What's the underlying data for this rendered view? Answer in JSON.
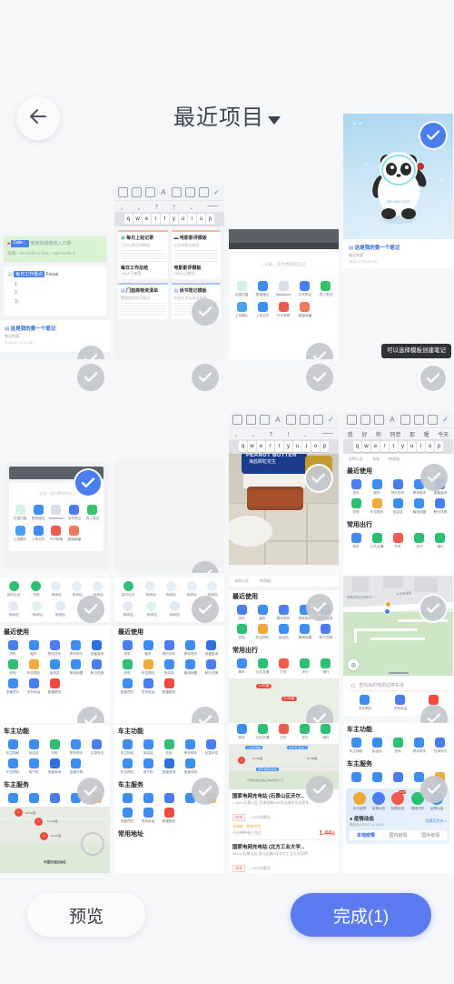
{
  "header": {
    "title": "最近项目",
    "back_icon": "arrow-left-icon",
    "caret_icon": "chevron-down-icon"
  },
  "tooltip": {
    "text": "可以选择模板创建笔记"
  },
  "bottom_bar": {
    "preview_label": "预览",
    "done_label": "完成(1)",
    "done_color": "#5b7cf0"
  },
  "selection": {
    "selected_count": 1,
    "check_icon": "check-icon",
    "selected_border_color": "#ef2f2f",
    "checked_color": "#4a7df0",
    "unchecked_color": "#c4c7cc"
  },
  "grid": {
    "columns": 4,
    "items": [
      {
        "id": "r1c1",
        "kind": "note-editor",
        "checked": false,
        "selected": false
      },
      {
        "id": "r1c2",
        "kind": "note-templates",
        "checked": false,
        "selected": false
      },
      {
        "id": "r1c3",
        "kind": "note-toolgrid",
        "checked": false,
        "selected": false
      },
      {
        "id": "r1c4",
        "kind": "panda-note",
        "checked": true,
        "selected": false
      },
      {
        "id": "r2c1",
        "kind": "note-firstnote",
        "checked": false,
        "selected": false
      },
      {
        "id": "r2c2",
        "kind": "blank",
        "checked": false,
        "selected": false
      },
      {
        "id": "r2c3",
        "kind": "blank",
        "checked": false,
        "selected": false
      },
      {
        "id": "r2c4",
        "kind": "tooltip-shot",
        "checked": false,
        "selected": false
      },
      {
        "id": "r3c1",
        "kind": "note-toolgrid-selected",
        "checked": true,
        "selected": true
      },
      {
        "id": "r3c2",
        "kind": "blank",
        "checked": false,
        "selected": false
      },
      {
        "id": "r3c3",
        "kind": "peanut-photo",
        "checked": false,
        "selected": false
      },
      {
        "id": "r3c4",
        "kind": "car-app-kb",
        "checked": false,
        "selected": false
      },
      {
        "id": "r4c1",
        "kind": "car-app-a",
        "checked": false,
        "selected": false
      },
      {
        "id": "r4c2",
        "kind": "car-app-a",
        "checked": false,
        "selected": false
      },
      {
        "id": "r4c3",
        "kind": "car-app-b",
        "checked": false,
        "selected": false
      },
      {
        "id": "r4c4",
        "kind": "map-parking",
        "checked": false,
        "selected": false
      },
      {
        "id": "r5c1",
        "kind": "car-app-c",
        "checked": false,
        "selected": false
      },
      {
        "id": "r5c2",
        "kind": "car-app-c",
        "checked": false,
        "selected": false
      },
      {
        "id": "r5c3",
        "kind": "charge-stations",
        "checked": false,
        "selected": false
      },
      {
        "id": "r5c4",
        "kind": "epidemic",
        "checked": false,
        "selected": false
      }
    ]
  },
  "note_app": {
    "highlight": {
      "date_label": "Date：",
      "hint_a": "使用快捷键插入日期",
      "hint_b": "日期：Alt+Shift+D    Mac：Opt+Shift+D"
    },
    "focus_card": {
      "tag": "每日工作重点",
      "suffix": "Focus",
      "items": [
        "1.",
        "2.",
        "3."
      ]
    },
    "first_note": {
      "title": "这是我的第一个笔记",
      "subtitle": "笔记内容",
      "time": "2022.07.13 12:20"
    }
  },
  "templates": {
    "toolbar_icons": [
      "comment-icon",
      "table-icon",
      "link-icon",
      "text-style-icon",
      "align-icon",
      "checkbox-icon",
      "image-icon",
      "done-icon"
    ],
    "symbol_row": [
      "，",
      "。",
      "？",
      "！",
      "、",
      "——"
    ],
    "key_row": [
      "q",
      "w",
      "e",
      "r",
      "t",
      "y",
      "u",
      "i",
      "o",
      "p"
    ],
    "cards": [
      {
        "title": "每日上班记录",
        "subtitle": "工作日常记录整理",
        "footer": "每日工作总结",
        "meta": "13k人已使用"
      },
      {
        "title": "电影影评模板",
        "subtitle": "记录观影的感受",
        "footer": "电影影评模板",
        "meta": "19k人已使用"
      },
      {
        "title": "门面高物资清单",
        "subtitle": "整理物资库存情况",
        "footer": "",
        "meta": ""
      },
      {
        "title": "读书笔记模板",
        "subtitle": "系统化消化阅读所得",
        "footer": "",
        "meta": ""
      }
    ]
  },
  "note_tools": {
    "hint": "记录，成为更好的自己",
    "row1": [
      {
        "label": "文档扫描",
        "color": "#3fc39a"
      },
      {
        "label": "语音速记",
        "color": "#3d8ef0"
      },
      {
        "label": "Markdown",
        "color": "#9aa4b6"
      },
      {
        "label": "手写笔记",
        "color": "#4a7df0"
      },
      {
        "label": "导入笔记",
        "color": "#35c26b"
      }
    ],
    "row2": [
      {
        "label": "上传图片",
        "color": "#4aa3f0"
      },
      {
        "label": "上传文件",
        "color": "#3d8ef0"
      },
      {
        "label": "PDF转换",
        "color": "#ef5b4f"
      },
      {
        "label": "链接收藏",
        "color": "#ef7a5b"
      }
    ]
  },
  "car_app": {
    "chips": [
      "实时公交",
      "充电",
      "待添加",
      "待添加",
      "待添加"
    ],
    "placeholder_label": "待添加",
    "sections": [
      {
        "title": "最近使用",
        "items": [
          {
            "label": "洗车",
            "color": "#4a7df0"
          },
          {
            "label": "租车",
            "color": "#3d8ef0"
          },
          {
            "label": "预约洗车",
            "color": "#4a7df0"
          },
          {
            "label": "停车助手",
            "color": "#3d8ef0"
          },
          {
            "label": "违章查询",
            "color": "#2f6fe0"
          },
          {
            "label": "充电",
            "color": "#2fbf74"
          },
          {
            "label": "车位预约",
            "color": "#f0a93d"
          },
          {
            "label": "加油站",
            "color": "#3d8ef0"
          },
          {
            "label": "离线地图",
            "color": "#3d8ef0"
          },
          {
            "label": "积分兑换",
            "color": "#4a7df0"
          },
          {
            "label": "违章罚付",
            "color": "#3d8ef0"
          },
          {
            "label": "洗车私运",
            "color": "#4a7df0"
          },
          {
            "label": "救援服务",
            "color": "#ef4a3d"
          }
        ]
      },
      {
        "title": "车主功能",
        "items": [
          {
            "label": "车主特权",
            "color": "#3d8ef0"
          },
          {
            "label": "加油站",
            "color": "#3d8ef0"
          },
          {
            "label": "充电",
            "color": "#2fbf74"
          },
          {
            "label": "停车助手",
            "color": "#3d8ef0"
          },
          {
            "label": "记录车位",
            "color": "#4a7df0"
          },
          {
            "label": "车位预约",
            "color": "#3d8ef0"
          },
          {
            "label": "电子狗",
            "color": "#3d8ef0"
          },
          {
            "label": "违章查询",
            "color": "#2f6fe0"
          },
          {
            "label": "违章车机",
            "color": "#3d8ef0"
          }
        ]
      },
      {
        "title": "车主服务",
        "items": [
          {
            "label": "违章罚付",
            "color": "#3d8ef0"
          },
          {
            "label": "洗车私运",
            "color": "#3d8ef0"
          },
          {
            "label": "救援服务",
            "color": "#4a7df0"
          },
          {
            "label": "道路救援",
            "color": "#3d8ef0"
          },
          {
            "label": "违章缴费",
            "color": "#f0a93d"
          }
        ]
      },
      {
        "title": "常用出行",
        "items": [
          {
            "label": "驾车",
            "color": "#3d8ef0"
          },
          {
            "label": "公共交通",
            "color": "#2fbf74"
          },
          {
            "label": "打车",
            "color": "#ef5b4f"
          },
          {
            "label": "步行",
            "color": "#2fbf74"
          },
          {
            "label": "骑行",
            "color": "#2fbf74"
          }
        ]
      },
      {
        "title": "常用地址",
        "items": []
      }
    ],
    "keyboard_suggestions": [
      "我",
      "好",
      "你",
      "同意",
      "那",
      "喔",
      "今天"
    ],
    "key_row": [
      "q",
      "w",
      "e",
      "r",
      "t",
      "y",
      "u",
      "i",
      "o",
      "p"
    ]
  },
  "map_app": {
    "search_placeholder": "查找目的地周边停车场",
    "locate_icon": "crosshair-icon",
    "quick_items": [
      {
        "label": "洗车预约",
        "color": "#3d8ef0"
      },
      {
        "label": "洗车私运",
        "color": "#4a7df0"
      },
      {
        "label": "救援车",
        "color": "#ef4a3d"
      }
    ]
  },
  "charge_app": {
    "stations": [
      {
        "name": "国家电网充电站 (石景山区沃尔...",
        "info": "1.4km·石景山区·苹果园路159号山姆信号员停车...",
        "badge": "快充",
        "hours": "24小时营业",
        "tag": "充电桩 · 剩余空位",
        "note": "可分钟种有人充过",
        "price": "1.44",
        "unit": "元"
      },
      {
        "name": "国家电网充电站 (北方工业大学...",
        "info": "861m·石景山区·晋元庄路5号北方工业大学园停...",
        "badge": "快充",
        "hours": "24小时营业",
        "tag": "",
        "note": "",
        "price": "",
        "unit": ""
      }
    ],
    "map_labels": [
      "公交充电桩",
      "停车场·出站口",
      "国家电网充电站",
      "万顺充电充电站·停车场出入口"
    ]
  },
  "epidemic_app": {
    "tiles": [
      {
        "label": "出行政策",
        "color": "#f0a93d"
      },
      {
        "label": "疫情动态",
        "color": "#4a7df0"
      },
      {
        "label": "核酸检测",
        "color": "#ef5b4f",
        "badge": "HOT"
      },
      {
        "label": "健康关怀",
        "color": "#2fbf74"
      },
      {
        "label": "疫情自查",
        "color": "#3d8ef0"
      }
    ],
    "section_title": "疫情动态",
    "update_time": "更新至2022.07.11 08:00",
    "location": "切换北京市 >",
    "tabs": [
      "本地疫情",
      "国内疫情",
      "国外疫情"
    ],
    "active_tab": "本地疫情"
  },
  "peanut_photo": {
    "brand_text": "PEANUT BUTTER",
    "chinese_text": "海盐颗粒花生"
  },
  "panda_image": {
    "alt": "bing-dwen-dwen-panda-mascot"
  }
}
